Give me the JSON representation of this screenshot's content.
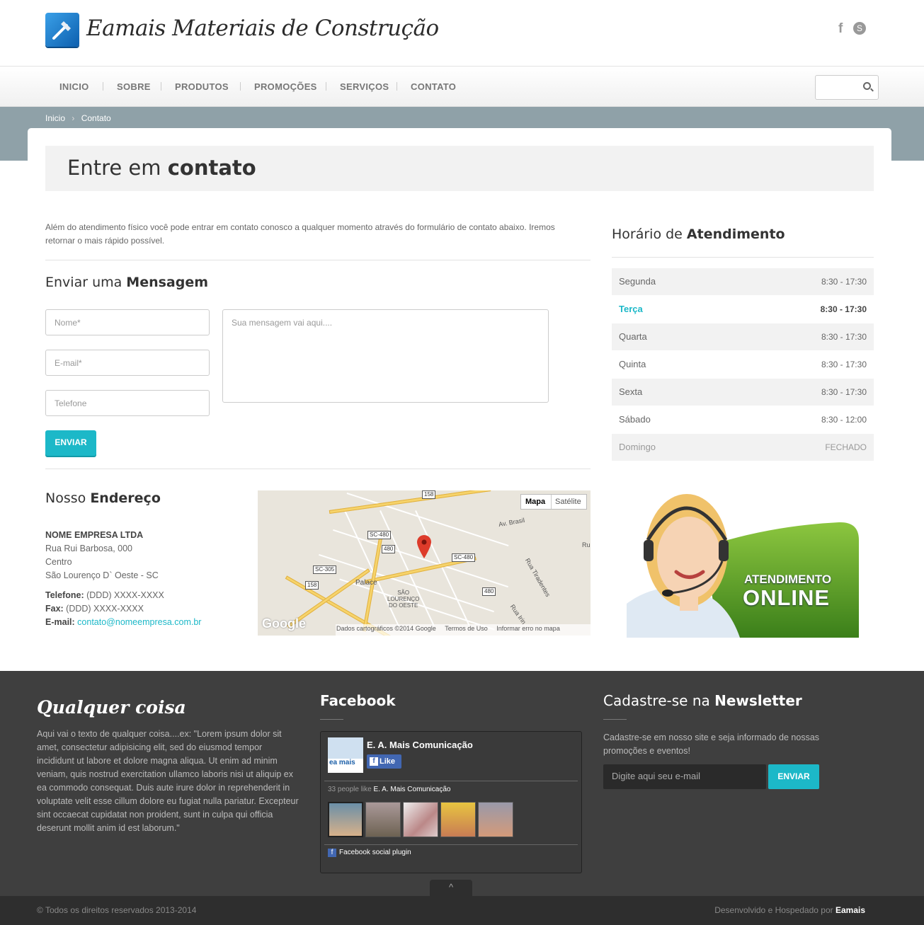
{
  "header": {
    "logo_text": "Eamais Materiais de Construção",
    "social": [
      "f",
      "S"
    ]
  },
  "nav": {
    "items": [
      "INICIO",
      "SOBRE",
      "PRODUTOS",
      "PROMOÇÕES",
      "SERVIÇOS",
      "CONTATO"
    ],
    "search_placeholder": ""
  },
  "breadcrumb": {
    "home": "Inicio",
    "sep": "›",
    "current": "Contato"
  },
  "page": {
    "title_light": "Entre em ",
    "title_bold": "contato"
  },
  "intro": "Além do atendimento físico você pode entrar em contato conosco a qualquer momento através do formulário de contato abaixo. Iremos retornar o mais rápido possível.",
  "form": {
    "heading_light": "Enviar uma ",
    "heading_bold": "Mensagem",
    "name_placeholder": "Nome*",
    "email_placeholder": "E-mail*",
    "phone_placeholder": "Telefone",
    "message_placeholder": "Sua mensagem vai aqui....",
    "send_label": "ENVIAR"
  },
  "address": {
    "heading_light": "Nosso ",
    "heading_bold": "Endereço",
    "company": "NOME EMPRESA LTDA",
    "street": "Rua Rui Barbosa, 000",
    "district": "Centro",
    "city": "São Lourenço D` Oeste - SC",
    "phone_label": "Telefone:",
    "phone": " (DDD) XXXX-XXXX",
    "fax_label": "Fax:",
    "fax": " (DDD) XXXX-XXXX",
    "email_label": "E-mail:",
    "email": "contato@nomeempresa.com.br"
  },
  "map": {
    "type_map": "Mapa",
    "type_sat": "Satélite",
    "labels": {
      "palace": "Palace",
      "city1": "SÃO",
      "city2": "LOURENÇO",
      "city3": "DO OESTE",
      "av_brasil": "Av. Brasil",
      "rua_tiradentes": "Rua Tiradentes",
      "rua_iri": "Rua Irin",
      "ru": "Ru"
    },
    "shields": [
      "158",
      "SC-480",
      "480",
      "SC-305",
      "158",
      "SC-480",
      "480",
      "158"
    ],
    "google": "Google",
    "attribution": "Dados cartográficos ©2014 Google",
    "terms": "Termos de Uso",
    "report": "Informar erro no mapa"
  },
  "schedule": {
    "heading_light": "Horário de ",
    "heading_bold": "Atendimento",
    "rows": [
      {
        "day": "Segunda",
        "hours": "8:30 - 17:30"
      },
      {
        "day": "Terça",
        "hours": "8:30 - 17:30"
      },
      {
        "day": "Quarta",
        "hours": "8:30 - 17:30"
      },
      {
        "day": "Quinta",
        "hours": "8:30 - 17:30"
      },
      {
        "day": "Sexta",
        "hours": "8:30 - 17:30"
      },
      {
        "day": "Sábado",
        "hours": "8:30 - 12:00"
      },
      {
        "day": "Domingo",
        "hours": "FECHADO"
      }
    ],
    "highlight_color": "#1cb8c8"
  },
  "banner": {
    "line1": "ATENDIMENTO",
    "line2": "ONLINE"
  },
  "footer": {
    "about_title": "Qualquer coisa",
    "about_text": "Aqui vai o texto de qualquer coisa....ex: \"Lorem ipsum dolor sit amet, consectetur adipisicing elit, sed do eiusmod tempor incididunt ut labore et dolore magna aliqua. Ut enim ad minim veniam, quis nostrud exercitation ullamco laboris nisi ut aliquip ex ea commodo consequat. Duis aute irure dolor in reprehenderit in voluptate velit esse cillum dolore eu fugiat nulla pariatur. Excepteur sint occaecat cupidatat non proident, sunt in culpa qui officia deserunt mollit anim id est laborum.\"",
    "facebook_title": "Facebook",
    "fb_page": "E. A. Mais Comunicação",
    "fb_like": "Like",
    "fb_count": "33 people like ",
    "fb_count_name": "E. A. Mais Comunicação",
    "fb_logo_text": "ea mais",
    "fb_plugin": "Facebook social plugin",
    "newsletter_light": "Cadastre-se na ",
    "newsletter_bold": "Newsletter",
    "newsletter_text": "Cadastre-se em nosso site e seja informado de nossas promoções e eventos!",
    "newsletter_placeholder": "Digite aqui seu e-mail",
    "newsletter_button": "ENVIAR",
    "copyright": "© Todos os direitos reservados 2013-2014",
    "dev_text": "Desenvolvido e Hospedado por ",
    "dev_brand": "Eamais",
    "to_top": "^"
  }
}
